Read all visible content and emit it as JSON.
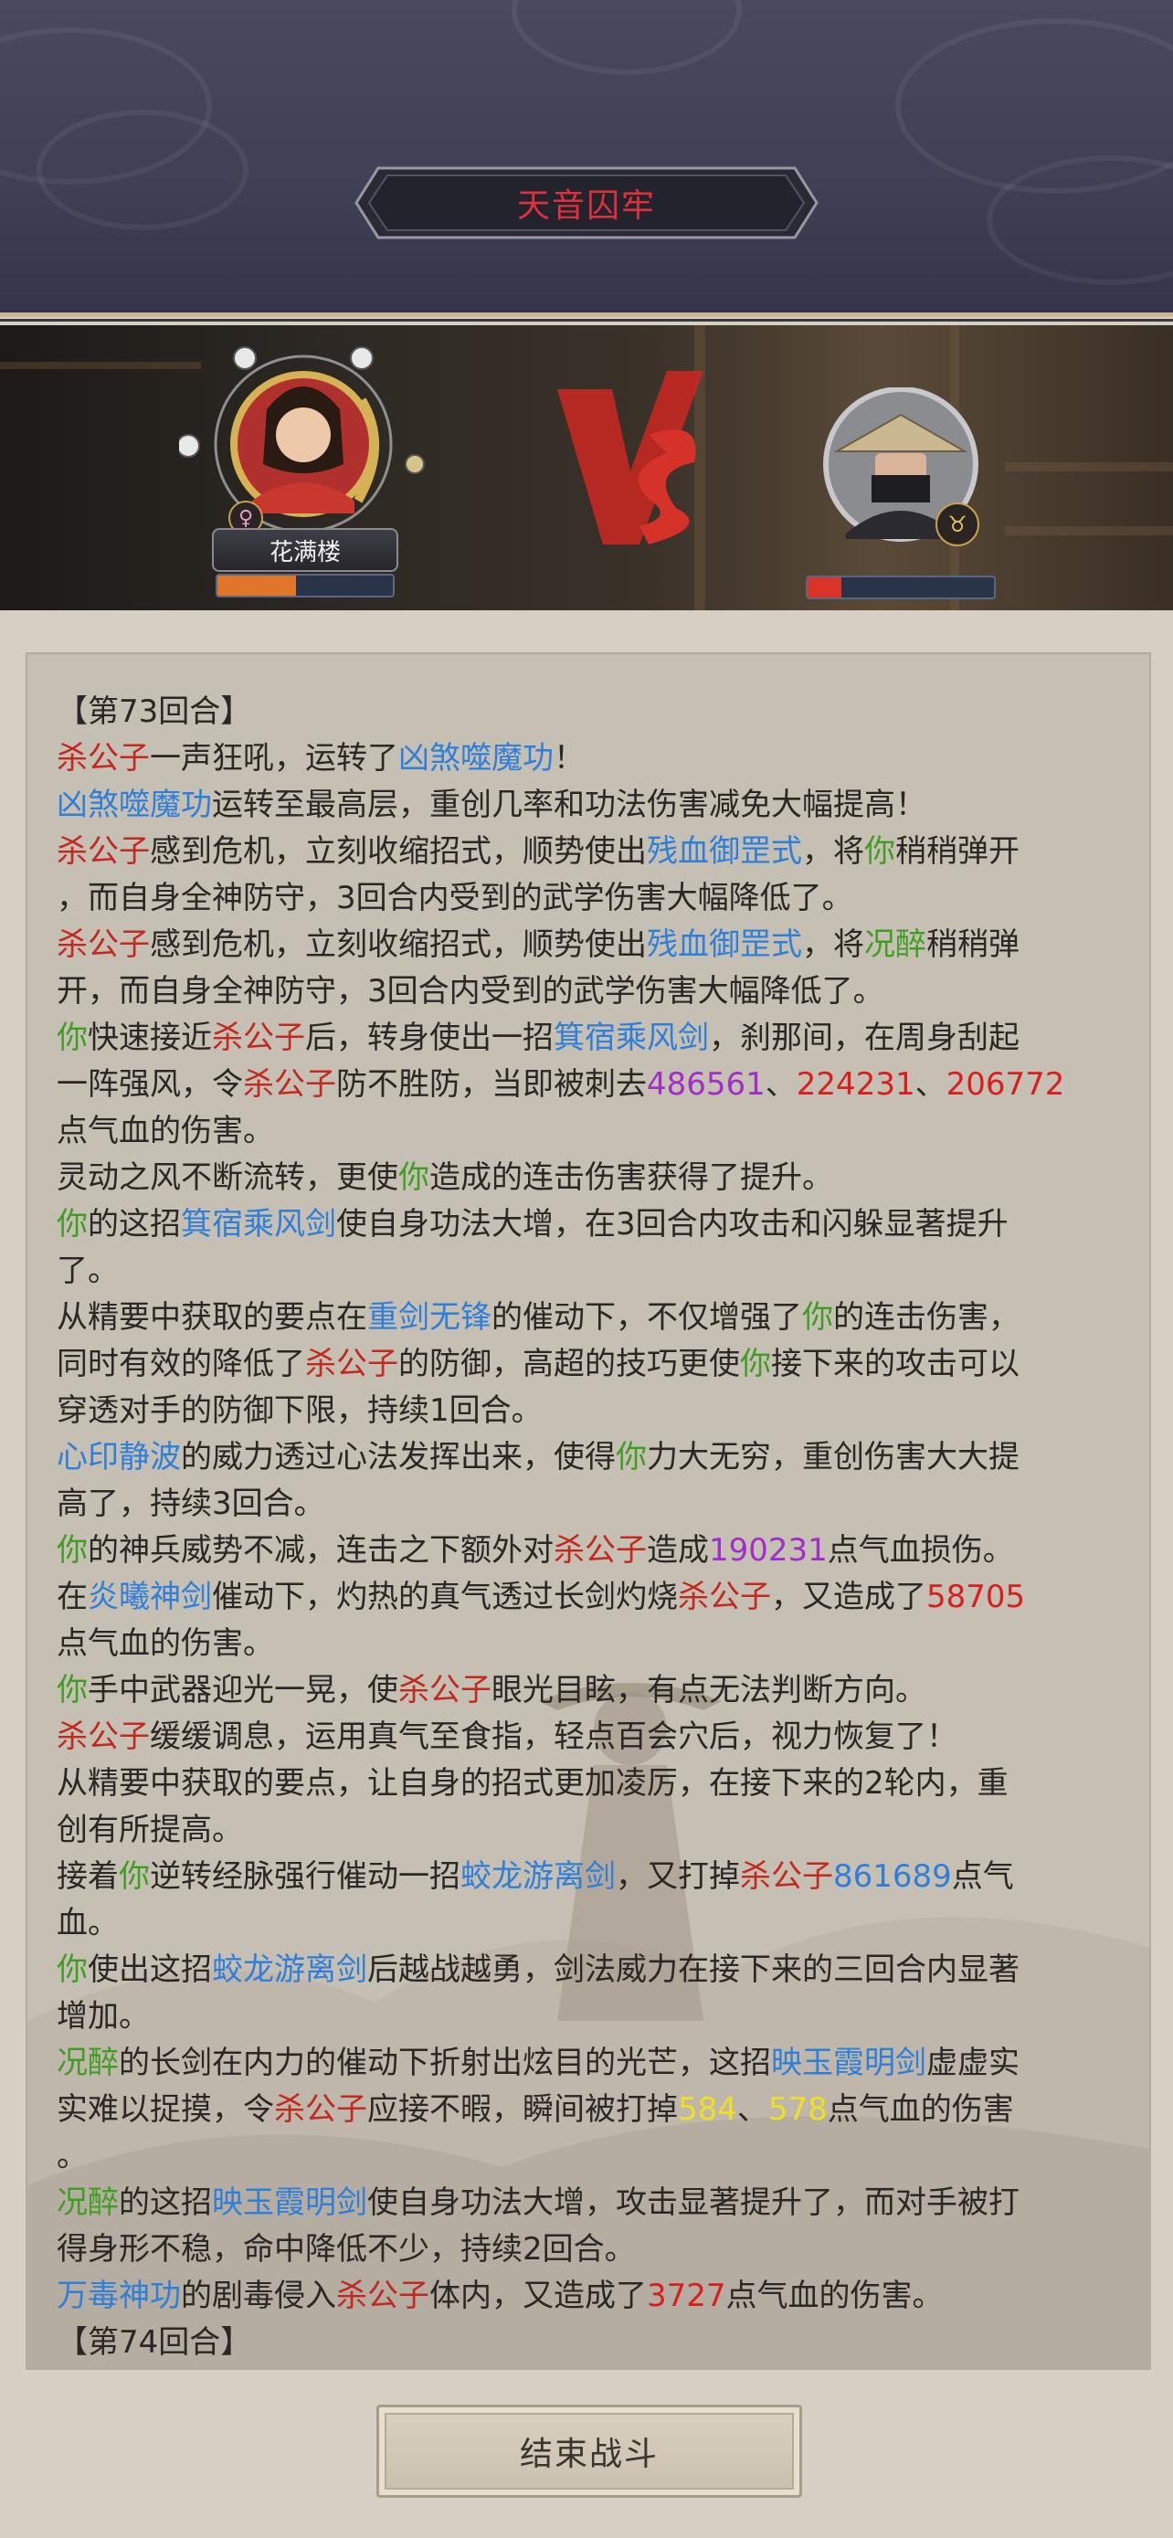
{
  "header": {
    "location_title": "天音囚牢"
  },
  "battle": {
    "player": {
      "name": "花满楼",
      "gender_icon": "female-icon",
      "hp_fraction": 0.45
    },
    "enemy": {
      "name": "",
      "hp_fraction": 0.18
    },
    "vs_label": "VS"
  },
  "log": {
    "lines": [
      [
        {
          "t": "【第73回合】",
          "c": ""
        }
      ],
      [
        {
          "t": "杀公子",
          "c": "red"
        },
        {
          "t": "一声狂吼，运转了",
          "c": ""
        },
        {
          "t": "凶煞噬魔功",
          "c": "blue"
        },
        {
          "t": "！",
          "c": ""
        }
      ],
      [
        {
          "t": "凶煞噬魔功",
          "c": "blue"
        },
        {
          "t": "运转至最高层，重创几率和功法伤害减免大幅提高！",
          "c": ""
        }
      ],
      [
        {
          "t": "杀公子",
          "c": "red"
        },
        {
          "t": "感到危机，立刻收缩招式，顺势使出",
          "c": ""
        },
        {
          "t": "残血御罡式",
          "c": "blue"
        },
        {
          "t": "，将",
          "c": ""
        },
        {
          "t": "你",
          "c": "green"
        },
        {
          "t": "稍稍弹开",
          "c": ""
        }
      ],
      [
        {
          "t": "，而自身全神防守，3回合内受到的武学伤害大幅降低了。",
          "c": ""
        }
      ],
      [
        {
          "t": "杀公子",
          "c": "red"
        },
        {
          "t": "感到危机，立刻收缩招式，顺势使出",
          "c": ""
        },
        {
          "t": "残血御罡式",
          "c": "blue"
        },
        {
          "t": "，将",
          "c": ""
        },
        {
          "t": "况醉",
          "c": "green"
        },
        {
          "t": "稍稍弹",
          "c": ""
        }
      ],
      [
        {
          "t": "开，而自身全神防守，3回合内受到的武学伤害大幅降低了。",
          "c": ""
        }
      ],
      [
        {
          "t": "你",
          "c": "green"
        },
        {
          "t": "快速接近",
          "c": ""
        },
        {
          "t": "杀公子",
          "c": "red"
        },
        {
          "t": "后，转身使出一招",
          "c": ""
        },
        {
          "t": "箕宿乘风剑",
          "c": "blue"
        },
        {
          "t": "，刹那间，在周身刮起",
          "c": ""
        }
      ],
      [
        {
          "t": "一阵强风，令",
          "c": ""
        },
        {
          "t": "杀公子",
          "c": "red"
        },
        {
          "t": "防不胜防，当即被刺去",
          "c": ""
        },
        {
          "t": "486561",
          "c": "purple"
        },
        {
          "t": "、",
          "c": ""
        },
        {
          "t": "224231",
          "c": "brightred"
        },
        {
          "t": "、",
          "c": ""
        },
        {
          "t": "206772",
          "c": "brightred"
        }
      ],
      [
        {
          "t": "点气血的伤害。",
          "c": ""
        }
      ],
      [
        {
          "t": "灵动之风不断流转，更使",
          "c": ""
        },
        {
          "t": "你",
          "c": "green"
        },
        {
          "t": "造成的连击伤害获得了提升。",
          "c": ""
        }
      ],
      [
        {
          "t": "你",
          "c": "green"
        },
        {
          "t": "的这招",
          "c": ""
        },
        {
          "t": "箕宿乘风剑",
          "c": "blue"
        },
        {
          "t": "使自身功法大增，在3回合内攻击和闪躲显著提升",
          "c": ""
        }
      ],
      [
        {
          "t": "了。",
          "c": ""
        }
      ],
      [
        {
          "t": "从精要中获取的要点在",
          "c": ""
        },
        {
          "t": "重剑无锋",
          "c": "blue"
        },
        {
          "t": "的催动下，不仅增强了",
          "c": ""
        },
        {
          "t": "你",
          "c": "green"
        },
        {
          "t": "的连击伤害，",
          "c": ""
        }
      ],
      [
        {
          "t": "同时有效的降低了",
          "c": ""
        },
        {
          "t": "杀公子",
          "c": "red"
        },
        {
          "t": "的防御，高超的技巧更使",
          "c": ""
        },
        {
          "t": "你",
          "c": "green"
        },
        {
          "t": "接下来的攻击可以",
          "c": ""
        }
      ],
      [
        {
          "t": "穿透对手的防御下限，持续1回合。",
          "c": ""
        }
      ],
      [
        {
          "t": "心印静波",
          "c": "blue"
        },
        {
          "t": "的威力透过心法发挥出来，使得",
          "c": ""
        },
        {
          "t": "你",
          "c": "green"
        },
        {
          "t": "力大无穷，重创伤害大大提",
          "c": ""
        }
      ],
      [
        {
          "t": "高了，持续3回合。",
          "c": ""
        }
      ],
      [
        {
          "t": "你",
          "c": "green"
        },
        {
          "t": "的神兵威势不减，连击之下额外对",
          "c": ""
        },
        {
          "t": "杀公子",
          "c": "red"
        },
        {
          "t": "造成",
          "c": ""
        },
        {
          "t": "190231",
          "c": "purple"
        },
        {
          "t": "点气血损伤。",
          "c": ""
        }
      ],
      [
        {
          "t": "在",
          "c": ""
        },
        {
          "t": "炎曦神剑",
          "c": "blue"
        },
        {
          "t": "催动下，灼热的真气透过长剑灼烧",
          "c": ""
        },
        {
          "t": "杀公子",
          "c": "red"
        },
        {
          "t": "，又造成了",
          "c": ""
        },
        {
          "t": "58705",
          "c": "brightred"
        }
      ],
      [
        {
          "t": "点气血的伤害。",
          "c": ""
        }
      ],
      [
        {
          "t": "你",
          "c": "green"
        },
        {
          "t": "手中武器迎光一晃，使",
          "c": ""
        },
        {
          "t": "杀公子",
          "c": "red"
        },
        {
          "t": "眼光目眩，有点无法判断方向。",
          "c": ""
        }
      ],
      [
        {
          "t": "杀公子",
          "c": "red"
        },
        {
          "t": "缓缓调息，运用真气至食指，轻点百会穴后，视力恢复了！",
          "c": ""
        }
      ],
      [
        {
          "t": "从精要中获取的要点，让自身的招式更加凌厉，在接下来的2轮内，重",
          "c": ""
        }
      ],
      [
        {
          "t": "创有所提高。",
          "c": ""
        }
      ],
      [
        {
          "t": "接着",
          "c": ""
        },
        {
          "t": "你",
          "c": "green"
        },
        {
          "t": "逆转经脉强行催动一招",
          "c": ""
        },
        {
          "t": "蛟龙游离剑",
          "c": "blue"
        },
        {
          "t": "，又打掉",
          "c": ""
        },
        {
          "t": "杀公子",
          "c": "red"
        },
        {
          "t": "861689",
          "c": "blue"
        },
        {
          "t": "点气",
          "c": ""
        }
      ],
      [
        {
          "t": "血。",
          "c": ""
        }
      ],
      [
        {
          "t": "你",
          "c": "green"
        },
        {
          "t": "使出这招",
          "c": ""
        },
        {
          "t": "蛟龙游离剑",
          "c": "blue"
        },
        {
          "t": "后越战越勇，剑法威力在接下来的三回合内显著",
          "c": ""
        }
      ],
      [
        {
          "t": "增加。",
          "c": ""
        }
      ],
      [
        {
          "t": "况醉",
          "c": "green"
        },
        {
          "t": "的长剑在内力的催动下折射出炫目的光芒，这招",
          "c": ""
        },
        {
          "t": "映玉霞明剑",
          "c": "blue"
        },
        {
          "t": "虚虚实",
          "c": ""
        }
      ],
      [
        {
          "t": "实难以捉摸，令",
          "c": ""
        },
        {
          "t": "杀公子",
          "c": "red"
        },
        {
          "t": "应接不暇，瞬间被打掉",
          "c": ""
        },
        {
          "t": "584",
          "c": "yellow"
        },
        {
          "t": "、",
          "c": ""
        },
        {
          "t": "578",
          "c": "yellow"
        },
        {
          "t": "点气血的伤害",
          "c": ""
        }
      ],
      [
        {
          "t": "。",
          "c": ""
        }
      ],
      [
        {
          "t": "况醉",
          "c": "green"
        },
        {
          "t": "的这招",
          "c": ""
        },
        {
          "t": "映玉霞明剑",
          "c": "blue"
        },
        {
          "t": "使自身功法大增，攻击显著提升了，而对手被打",
          "c": ""
        }
      ],
      [
        {
          "t": "得身形不稳，命中降低不少，持续2回合。",
          "c": ""
        }
      ],
      [
        {
          "t": "万毒神功",
          "c": "blue"
        },
        {
          "t": "的剧毒侵入",
          "c": ""
        },
        {
          "t": "杀公子",
          "c": "red"
        },
        {
          "t": "体内，又造成了",
          "c": ""
        },
        {
          "t": "3727",
          "c": "brightred"
        },
        {
          "t": "点气血的伤害。",
          "c": ""
        }
      ],
      [
        {
          "t": "【第74回合】",
          "c": ""
        }
      ]
    ]
  },
  "footer": {
    "end_battle_label": "结束战斗"
  },
  "colors": {
    "enemy_name": "#c2291f",
    "skill": "#2f7fd9",
    "ally": "#3f9e22",
    "crit_damage": "#a12ec8",
    "damage": "#d91e1e",
    "minor_damage": "#f0e020"
  }
}
